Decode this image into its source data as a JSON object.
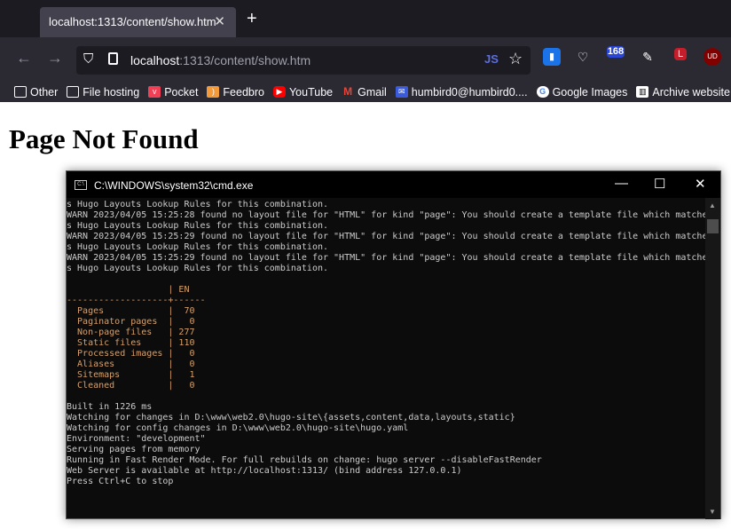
{
  "browser": {
    "tab_title": "localhost:1313/content/show.htm",
    "url_host": "localhost",
    "url_rest": ":1313/content/show.htm",
    "extensions": {
      "badge_count": "168",
      "lastpass_badge": "L",
      "ublock": "UD"
    },
    "bookmarks": [
      "Other",
      "File hosting",
      "Pocket",
      "Feedbro",
      "YouTube",
      "Gmail",
      "humbird0@humbird0....",
      "Google Images",
      "Archive website"
    ]
  },
  "page": {
    "heading": "Page Not Found"
  },
  "cmd": {
    "title": "C:\\WINDOWS\\system32\\cmd.exe",
    "lines": [
      "s Hugo Layouts Lookup Rules for this combination.",
      "WARN 2023/04/05 15:25:28 found no layout file for \"HTML\" for kind \"page\": You should create a template file which matche",
      "s Hugo Layouts Lookup Rules for this combination.",
      "WARN 2023/04/05 15:25:29 found no layout file for \"HTML\" for kind \"page\": You should create a template file which matche",
      "s Hugo Layouts Lookup Rules for this combination.",
      "WARN 2023/04/05 15:25:29 found no layout file for \"HTML\" for kind \"page\": You should create a template file which matche",
      "s Hugo Layouts Lookup Rules for this combination.",
      "",
      "                   | EN",
      "-------------------+------",
      "  Pages            |  70",
      "  Paginator pages  |   0",
      "  Non-page files   | 277",
      "  Static files     | 110",
      "  Processed images |   0",
      "  Aliases          |   0",
      "  Sitemaps         |   1",
      "  Cleaned          |   0",
      "",
      "Built in 1226 ms",
      "Watching for changes in D:\\www\\web2.0\\hugo-site\\{assets,content,data,layouts,static}",
      "Watching for config changes in D:\\www\\web2.0\\hugo-site\\hugo.yaml",
      "Environment: \"development\"",
      "Serving pages from memory",
      "Running in Fast Render Mode. For full rebuilds on change: hugo server --disableFastRender",
      "Web Server is available at http://localhost:1313/ (bind address 127.0.0.1)",
      "Press Ctrl+C to stop"
    ]
  }
}
